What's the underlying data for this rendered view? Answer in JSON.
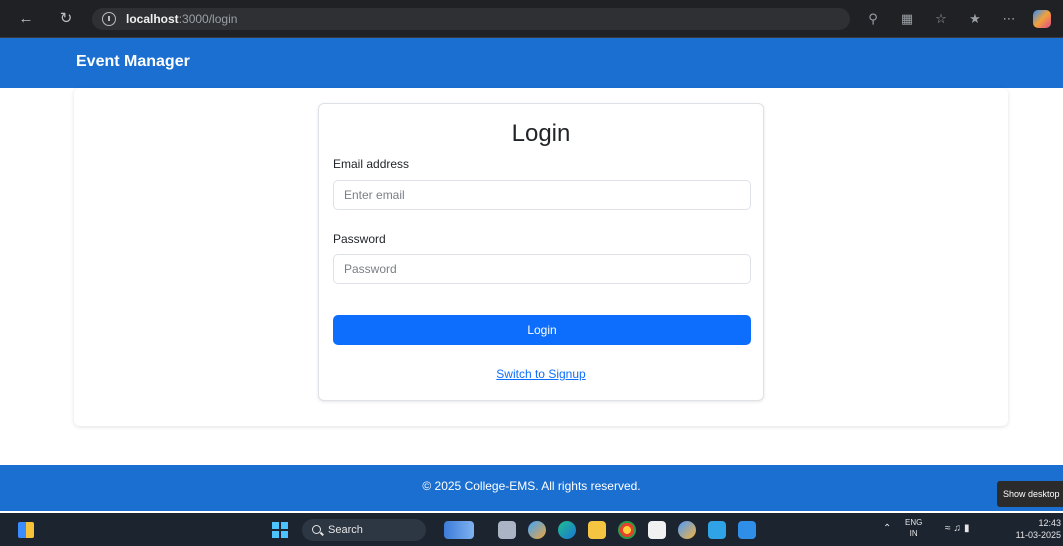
{
  "browser": {
    "url_host": "localhost",
    "url_path": ":3000/login"
  },
  "header": {
    "brand": "Event Manager"
  },
  "login": {
    "title": "Login",
    "email_label": "Email address",
    "email_placeholder": "Enter email",
    "email_value": "",
    "password_label": "Password",
    "password_placeholder": "Password",
    "password_value": "",
    "submit_label": "Login",
    "switch_label": "Switch to Signup"
  },
  "footer": {
    "text": "© 2025 College-EMS. All rights reserved."
  },
  "taskbar": {
    "show_desktop": "Show desktop",
    "search_label": "Search",
    "lang_top": "ENG",
    "lang_bottom": "IN",
    "time": "12:43",
    "date": "11-03-2025"
  },
  "colors": {
    "primary": "#0d6efd",
    "header_bg": "#1a6fd1",
    "taskbar_bg": "#1c2430"
  }
}
